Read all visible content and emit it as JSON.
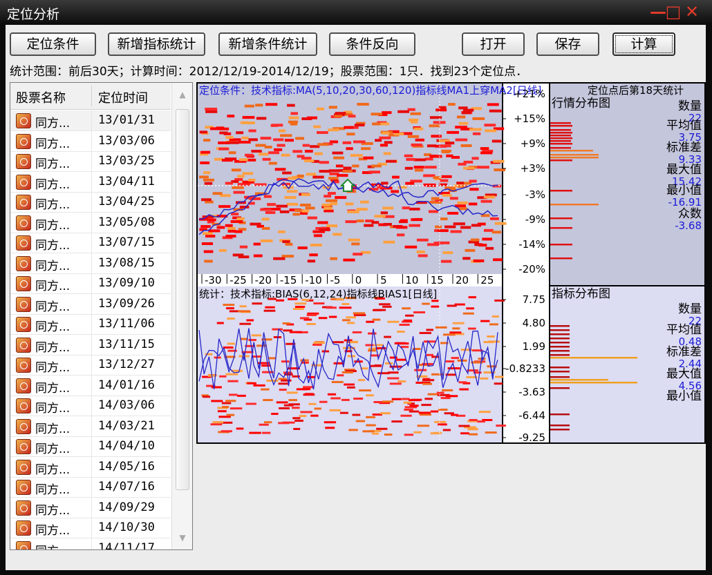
{
  "window": {
    "title": "定位分析",
    "min_glyph": "—",
    "max_glyph": "□",
    "close_glyph": "✕"
  },
  "toolbar": {
    "buttons": [
      {
        "label": "定位条件"
      },
      {
        "label": "新增指标统计"
      },
      {
        "label": "新增条件统计"
      },
      {
        "label": "条件反向"
      },
      {
        "label": "打开"
      },
      {
        "label": "保存"
      },
      {
        "label": "计算"
      }
    ]
  },
  "info_text": "统计范围：前后30天；计算时间：2012/12/19-2014/12/19；股票范围：1只．找到23个定位点．",
  "list": {
    "columns": [
      "股票名称",
      "定位时间"
    ],
    "rows": [
      {
        "name": "同方...",
        "date": "13/01/31"
      },
      {
        "name": "同方...",
        "date": "13/03/06"
      },
      {
        "name": "同方...",
        "date": "13/03/25"
      },
      {
        "name": "同方...",
        "date": "13/04/11"
      },
      {
        "name": "同方...",
        "date": "13/04/25"
      },
      {
        "name": "同方...",
        "date": "13/05/08"
      },
      {
        "name": "同方...",
        "date": "13/07/15"
      },
      {
        "name": "同方...",
        "date": "13/08/15"
      },
      {
        "name": "同方...",
        "date": "13/09/10"
      },
      {
        "name": "同方...",
        "date": "13/09/26"
      },
      {
        "name": "同方...",
        "date": "13/11/06"
      },
      {
        "name": "同方...",
        "date": "13/11/15"
      },
      {
        "name": "同方...",
        "date": "13/12/27"
      },
      {
        "name": "同方...",
        "date": "14/01/16"
      },
      {
        "name": "同方...",
        "date": "14/03/06"
      },
      {
        "name": "同方...",
        "date": "14/03/21"
      },
      {
        "name": "同方...",
        "date": "14/04/10"
      },
      {
        "name": "同方...",
        "date": "14/05/16"
      },
      {
        "name": "同方...",
        "date": "14/07/16"
      },
      {
        "name": "同方...",
        "date": "14/09/29"
      },
      {
        "name": "同方...",
        "date": "14/10/30"
      },
      {
        "name": "同方...",
        "date": "14/11/17"
      }
    ]
  },
  "chart_top": {
    "title": "定位条件：技术指标:MA(5,10,20,30,60,120)指标线MA1上穿MA2[日线]",
    "right_title": "定位点后第18天统计",
    "dist_title": "行情分布图",
    "y_ticks": [
      "+21%",
      "+15%",
      "+9%",
      "+3%",
      "-3%",
      "-9%",
      "-14%",
      "-20%"
    ],
    "x_ticks": [
      "-30",
      "-25",
      "-20",
      "-15",
      "-10",
      "-5",
      "0",
      "5",
      "10",
      "15",
      "20",
      "25"
    ],
    "stats": [
      {
        "label": "数量",
        "value": "22"
      },
      {
        "label": "平均值",
        "value": "3.75"
      },
      {
        "label": "标准差",
        "value": "9.33"
      },
      {
        "label": "最大值",
        "value": "15.42"
      },
      {
        "label": "最小值",
        "value": "-16.91"
      },
      {
        "label": "众数",
        "value": "-3.68"
      }
    ]
  },
  "chart_bottom": {
    "title": "统计：技术指标:BIAS(6,12,24)指标线BIAS1[日线]",
    "dist_title": "指标分布图",
    "y_ticks": [
      "7.75",
      "4.80",
      "1.99",
      "-0.8233",
      "-3.63",
      "-6.44",
      "-9.25"
    ],
    "stats": [
      {
        "label": "数量",
        "value": "22"
      },
      {
        "label": "平均值",
        "value": "0.48"
      },
      {
        "label": "标准差",
        "value": "2.44"
      },
      {
        "label": "最大值",
        "value": "4.56"
      },
      {
        "label": "最小值",
        "value": ""
      }
    ]
  },
  "colors": {
    "top_bg": "#c4c6dc",
    "bottom_bg": "#dcdcf3",
    "line": "#2626c8",
    "stat_value": "#1a1ad6"
  }
}
